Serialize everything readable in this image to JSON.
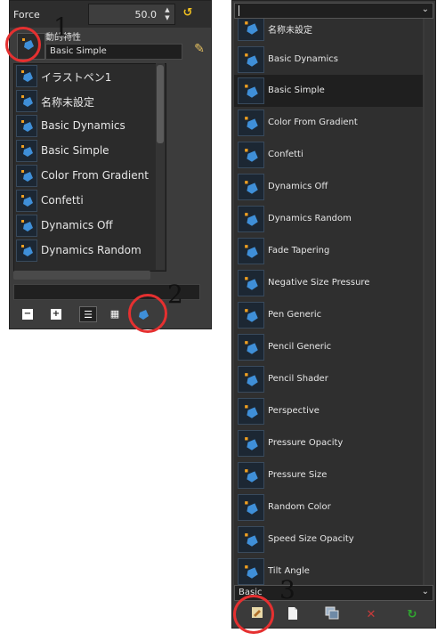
{
  "left": {
    "force_label": "Force",
    "force_value": "50.0",
    "dynamics_heading": "動的特性",
    "dynamics_name": "Basic Simple",
    "list_items": [
      "イラストペン1",
      "名称未設定",
      "Basic Dynamics",
      "Basic Simple",
      "Color From Gradient",
      "Confetti",
      "Dynamics Off",
      "Dynamics Random"
    ]
  },
  "right": {
    "list_items": [
      "名称未設定",
      "Basic Dynamics",
      "Basic Simple",
      "Color From Gradient",
      "Confetti",
      "Dynamics Off",
      "Dynamics Random",
      "Fade Tapering",
      "Negative Size Pressure",
      "Pen Generic",
      "Pencil Generic",
      "Pencil Shader",
      "Perspective",
      "Pressure Opacity",
      "Pressure Size",
      "Random Color",
      "Speed Size Opacity",
      "Tilt Angle"
    ],
    "selected_item": "Basic Simple",
    "tag_filter_value": "Basic"
  },
  "annotations": [
    "1",
    "2",
    "3"
  ],
  "colors": {
    "annotation": "#e53030",
    "panel_bg": "#3c3c3c",
    "thumb_bg": "#1c2733",
    "brush_blue": "#3f8fd8",
    "brush_accent": "#f0a020"
  }
}
